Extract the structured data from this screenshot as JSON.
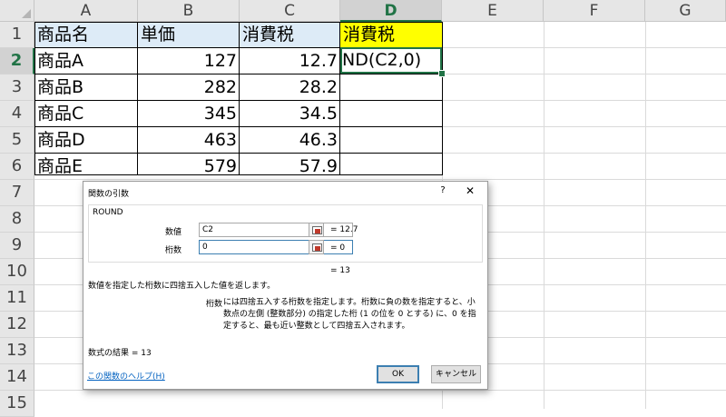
{
  "columns": [
    "A",
    "B",
    "C",
    "D",
    "E",
    "F",
    "G"
  ],
  "selected_column": "D",
  "rows": [
    "1",
    "2",
    "3",
    "4",
    "5",
    "6",
    "7",
    "8",
    "9",
    "10",
    "11",
    "12",
    "13",
    "14",
    "15"
  ],
  "selected_row": "2",
  "header_row": [
    "商品名",
    "単価",
    "消費税",
    "消費税"
  ],
  "data_rows": [
    {
      "name": "商品A",
      "price": "127",
      "tax": "12.7"
    },
    {
      "name": "商品B",
      "price": "282",
      "tax": "28.2"
    },
    {
      "name": "商品C",
      "price": "345",
      "tax": "34.5"
    },
    {
      "name": "商品D",
      "price": "463",
      "tax": "46.3"
    },
    {
      "name": "商品E",
      "price": "579",
      "tax": "57.9"
    }
  ],
  "active_cell_text": "ND(C2,0)",
  "colors": {
    "accent": "#217346",
    "header_fill": "#ddebf7",
    "highlight_fill": "#ffff00",
    "link": "#0563c1"
  },
  "dialog": {
    "title": "関数の引数",
    "help": "?",
    "close": "✕",
    "function_name": "ROUND",
    "args": [
      {
        "label": "数値",
        "value": "C2",
        "result": "= 12.7"
      },
      {
        "label": "桁数",
        "value": "0",
        "result": "= 0"
      }
    ],
    "formula_result_short": "= 13",
    "description": "数値を指定した桁数に四捨五入した値を返します。",
    "arg_name": "桁数",
    "arg_description": "には四捨五入する桁数を指定します。桁数に負の数を指定すると、小数点の左側 (整数部分) の指定した桁 (1 の位を 0 とする) に、0 を指定すると、最も近い整数として四捨五入されます。",
    "formula_result": "数式の結果 =  13",
    "help_link": "この関数のヘルプ(H)",
    "ok": "OK",
    "cancel": "キャンセル"
  }
}
